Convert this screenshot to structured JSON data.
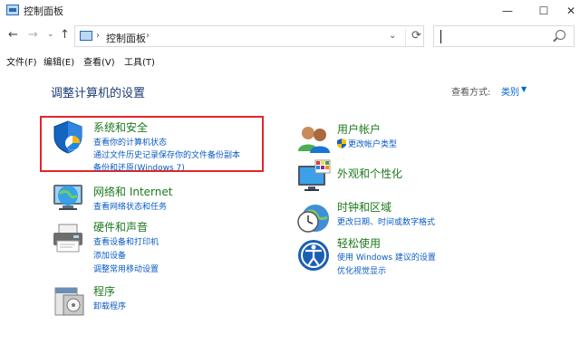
{
  "window": {
    "title": "控制面板"
  },
  "window_controls": {
    "minimize": "—",
    "maximize": "☐",
    "close": "✕"
  },
  "nav": {
    "back": "←",
    "forward": "→",
    "history": "⌄",
    "up": "↑",
    "sep": "›",
    "address": "控制面板",
    "dropdown": "⌄",
    "refresh": "⟳",
    "search_value": ""
  },
  "menu": {
    "file": "文件(F)",
    "edit": "编辑(E)",
    "view": "查看(V)",
    "tools": "工具(T)"
  },
  "content": {
    "heading": "调整计算机的设置",
    "view_by_label": "查看方式:",
    "view_by_value": "类别",
    "view_by_arrow": "▼"
  },
  "categories": {
    "system_security": {
      "title": "系统和安全",
      "links": [
        "查看你的计算机状态",
        "通过文件历史记录保存你的文件备份副本",
        "备份和还原(Windows 7)"
      ]
    },
    "network": {
      "title": "网络和 Internet",
      "links": [
        "查看网络状态和任务"
      ]
    },
    "hardware": {
      "title": "硬件和声音",
      "links": [
        "查看设备和打印机",
        "添加设备",
        "调整常用移动设置"
      ]
    },
    "programs": {
      "title": "程序",
      "links": [
        "卸载程序"
      ]
    },
    "user_accounts": {
      "title": "用户帐户",
      "links": [
        "更改帐户类型"
      ]
    },
    "appearance": {
      "title": "外观和个性化",
      "links": []
    },
    "clock_region": {
      "title": "时钟和区域",
      "links": [
        "更改日期、时间或数字格式"
      ]
    },
    "ease_access": {
      "title": "轻松使用",
      "links": [
        "使用 Windows 建议的设置",
        "优化视觉显示"
      ]
    }
  },
  "colors": {
    "category_title": "#1d7a1d",
    "link": "#0a5bc4",
    "heading": "#1c3d73",
    "highlight": "#e1262b"
  },
  "icons": [
    "shield-icon",
    "network-globe-icon",
    "printer-icon",
    "programs-icon",
    "users-icon",
    "monitor-palette-icon",
    "clock-globe-icon",
    "ease-access-icon",
    "uac-shield-icon"
  ]
}
